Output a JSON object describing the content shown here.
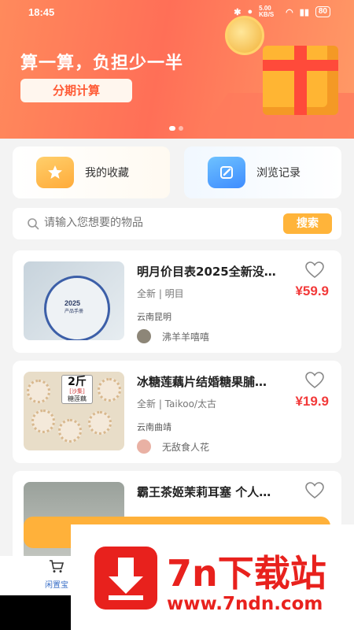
{
  "status_bar": {
    "time": "18:45",
    "net_speed": "5.00 KB/S",
    "battery": "80"
  },
  "banner": {
    "title": "算一算，负担少一半",
    "button_label": "分期计算"
  },
  "quick_links": [
    {
      "label": "我的收藏",
      "icon": "star-icon"
    },
    {
      "label": "浏览记录",
      "icon": "pencil-icon"
    }
  ],
  "search": {
    "placeholder": "请输入您想要的物品",
    "button_label": "搜索"
  },
  "items": [
    {
      "title": "明月价目表2025全新没…",
      "condition": "全新 | 明目",
      "price": "¥59.9",
      "location": "云南昆明",
      "seller": "沸羊羊嘻嘻",
      "thumb": {
        "line1": "2025",
        "line2": "产品手册"
      }
    },
    {
      "title": "冰糖莲藕片结婚糖果脯…",
      "condition": "全新 | Taikoo/太古",
      "price": "¥19.9",
      "location": "云南曲靖",
      "seller": "无敌食人花",
      "thumb": {
        "weight": "2斤",
        "brand": "[沙集]",
        "name": "糖莲藕"
      }
    },
    {
      "title": "霸王茶姬茉莉耳塞 个人…",
      "condition": "",
      "price": "",
      "location": "",
      "seller": ""
    }
  ],
  "tabbar": {
    "home_label": "闲置宝"
  },
  "watermark": {
    "name": "7n下载站",
    "url": "www.7ndn.com"
  },
  "colors": {
    "accent": "#ffb43a",
    "price": "#f23a3a",
    "banner": "#ff7a5a",
    "watermark": "#e8211d"
  }
}
